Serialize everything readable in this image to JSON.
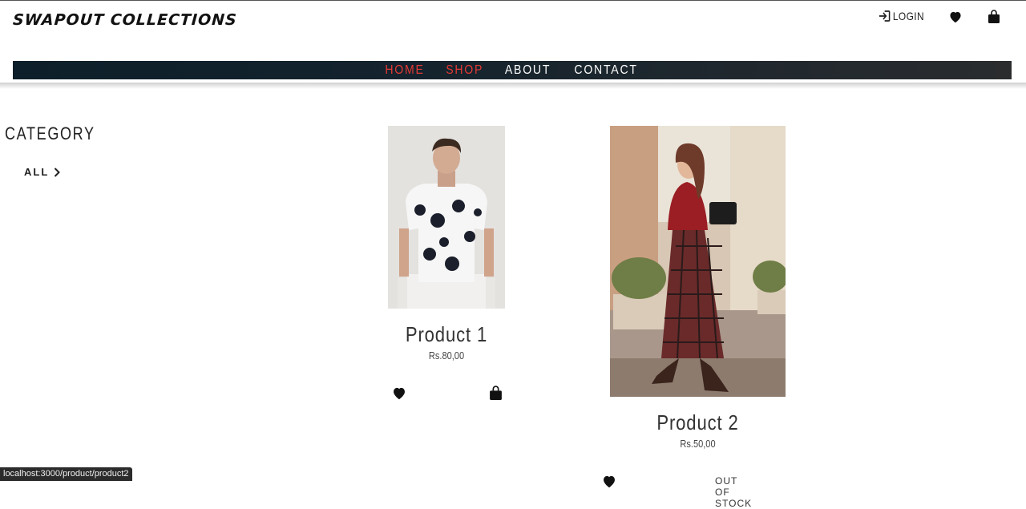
{
  "brand": {
    "name": "SWAPOUT COLLECTIONS"
  },
  "header": {
    "login_label": "LOGIN",
    "icons": [
      "login-icon",
      "heart-icon",
      "shopping-bag-icon"
    ]
  },
  "nav": {
    "items": [
      {
        "label": "HOME",
        "active": true
      },
      {
        "label": "SHOP",
        "active": true
      },
      {
        "label": "ABOUT",
        "active": false
      },
      {
        "label": "CONTACT",
        "active": false
      }
    ]
  },
  "sidebar": {
    "title": "CATEGORY",
    "items": [
      {
        "label": "ALL"
      }
    ]
  },
  "products": [
    {
      "name": "Product 1",
      "price": "Rs.80,00"
    },
    {
      "name": "Product 2",
      "price": "Rs.50,00",
      "stock_label": "OUT OF STOCK"
    }
  ],
  "status_bar": {
    "url": "localhost:3000/product/product2"
  },
  "colors": {
    "accent": "#e53935",
    "nav_bg": "#14232d"
  }
}
